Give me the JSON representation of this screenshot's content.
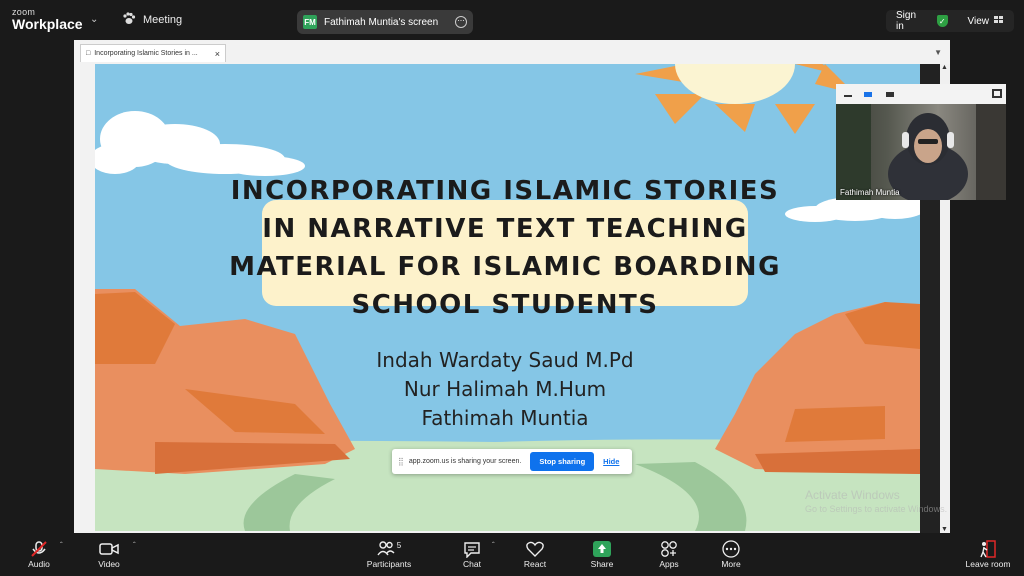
{
  "topbar": {
    "brand_small": "zoom",
    "brand_large": "Workplace",
    "meeting_label": "Meeting",
    "share_badge": "FM",
    "share_label": "Fathimah Muntia's screen",
    "sign_in": "Sign in",
    "view_label": "View"
  },
  "browser": {
    "tab_title": "Incorporating Islamic Stories in ..."
  },
  "slide": {
    "title": "Incorporating Islamic Stories in Narrative Text Teaching Material for Islamic Boarding School Students",
    "authors": [
      "Indah Wardaty Saud M.Pd",
      "Nur Halimah M.Hum",
      "Fathimah Muntia"
    ]
  },
  "share_notice": {
    "text": "app.zoom.us is sharing your screen.",
    "stop_label": "Stop sharing",
    "hide_label": "Hide"
  },
  "video": {
    "participant_name": "Fathimah Muntia"
  },
  "watermark": {
    "line1": "Activate Windows",
    "line2": "Go to Settings to activate Windows."
  },
  "toolbar": {
    "audio": "Audio",
    "video": "Video",
    "participants": "Participants",
    "participants_count": "5",
    "chat": "Chat",
    "react": "React",
    "share": "Share",
    "apps": "Apps",
    "more": "More",
    "leave": "Leave room"
  },
  "colors": {
    "sky": "#85c6e6",
    "title_box": "#fdf2cb",
    "rock": "#e98f5f",
    "rock_dark": "#e07a3a",
    "grass": "#c6e4c0",
    "sun": "#fbf4d2",
    "sun_rays": "#f0a04a",
    "zoom_blue": "#0e72ed",
    "share_green": "#2fa35a"
  }
}
